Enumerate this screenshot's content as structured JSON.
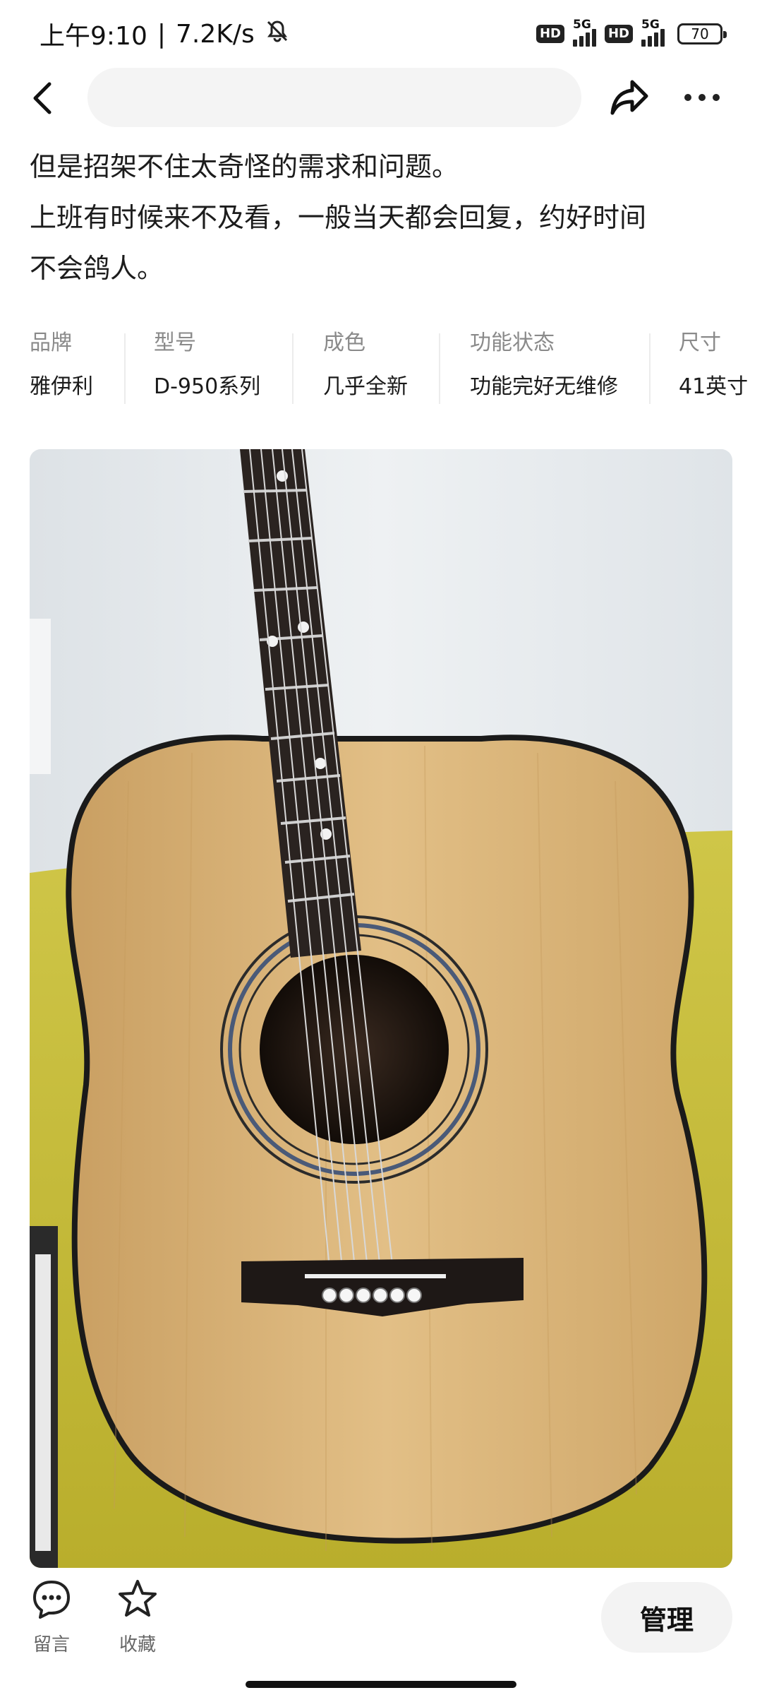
{
  "status_bar": {
    "time": "上午9:10",
    "speed": "7.2K/s",
    "hd1": "HD",
    "net1": "5G",
    "hd2": "HD",
    "net2": "5G",
    "battery": "70"
  },
  "nav": {
    "icons": [
      "back-icon",
      "share-icon",
      "more-icon"
    ]
  },
  "description": {
    "lines": [
      "但是招架不住太奇怪的需求和问题。",
      "上班有时候来不及看，一般当天都会回复，约好时间",
      "不会鸽人。"
    ]
  },
  "specs": [
    {
      "label": "品牌",
      "value": "雅伊利"
    },
    {
      "label": "型号",
      "value": "D-950系列"
    },
    {
      "label": "成色",
      "value": "几乎全新"
    },
    {
      "label": "功能状态",
      "value": "功能完好无维修"
    },
    {
      "label": "尺寸",
      "value": "41英寸"
    }
  ],
  "photo": {
    "subject": "acoustic guitar"
  },
  "bottom_bar": {
    "comment_label": "留言",
    "favorite_label": "收藏",
    "manage_label": "管理"
  },
  "colors": {
    "text_primary": "#1a1a1a",
    "text_secondary": "#8a8a8a",
    "wall": "#e9ecef",
    "sofa": "#c9c23a",
    "guitar_top": "#dcb57a",
    "fretboard": "#2a2320"
  }
}
